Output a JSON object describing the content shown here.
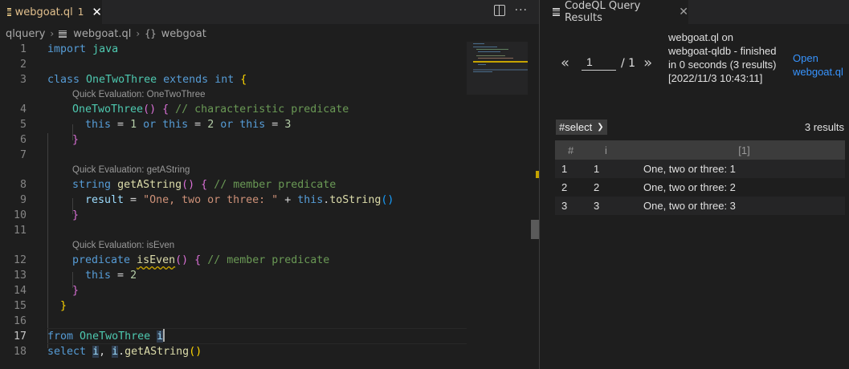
{
  "editor_tab": {
    "filename": "webgoat.ql",
    "problems": "1",
    "close": "✕"
  },
  "breadcrumb": {
    "folder": "qlquery",
    "file": "webgoat.ql",
    "symbol": "webgoat",
    "braces": "{}",
    "sep": "›"
  },
  "editor_actions": {
    "more": "···"
  },
  "code": {
    "line_numbers": [
      "1",
      "2",
      "3",
      "4",
      "5",
      "6",
      "7",
      "8",
      "9",
      "10",
      "11",
      "12",
      "13",
      "14",
      "15",
      "16",
      "17",
      "18"
    ],
    "l1": {
      "kw": "import",
      "lib": "java"
    },
    "l3": {
      "kw_class": "class",
      "name": "OneTwoThree",
      "kw_extends": "extends",
      "base": "int",
      "brace": "{"
    },
    "lens1": "Quick Evaluation: OneTwoThree",
    "l4": {
      "ctor": "OneTwoThree",
      "parens": "()",
      "brace": "{",
      "comment": "// characteristic predicate"
    },
    "l5": {
      "this1": "this",
      "eq1": " = ",
      "n1": "1",
      "or1": "or",
      "this2": "this",
      "eq2": " = ",
      "n2": "2",
      "or2": "or",
      "this3": "this",
      "eq3": " = ",
      "n3": "3"
    },
    "l6": {
      "brace": "}"
    },
    "lens2": "Quick Evaluation: getAString",
    "l8": {
      "type": "string",
      "method": "getAString",
      "parens": "()",
      "brace": "{",
      "comment": "// member predicate"
    },
    "l9": {
      "result": "result",
      "eq": " = ",
      "str": "\"One, two or three: \"",
      "plus": " + ",
      "this": "this",
      "dot": ".",
      "call": "toString",
      "parens": "()"
    },
    "l10": {
      "brace": "}"
    },
    "lens3": "Quick Evaluation: isEven",
    "l12": {
      "kw": "predicate",
      "method": "isEven",
      "parens": "()",
      "brace": "{",
      "comment": "// member predicate"
    },
    "l13": {
      "this": "this",
      "eq": " = ",
      "num": "2"
    },
    "l14": {
      "brace": "}"
    },
    "l15": {
      "brace": "}"
    },
    "l17": {
      "kw": "from",
      "type": "OneTwoThree",
      "var": "i"
    },
    "l18": {
      "kw": "select",
      "var1": "i",
      "comma": ", ",
      "var2": "i",
      "dot": ".",
      "call": "getAString",
      "parens": "()"
    }
  },
  "results_panel": {
    "tab_title": "CodeQL Query Results",
    "close": "✕",
    "pager": {
      "prev": "«",
      "page": "1",
      "total": "/ 1",
      "next": "»"
    },
    "run_info": "webgoat.ql on webgoat-qldb - finished in 0 seconds (3 results) [2022/11/3 10:43:11]",
    "open_link": "Open webgoat.ql",
    "result_set": "#select",
    "result_count": "3 results",
    "columns": [
      "#",
      "i",
      "[1]"
    ],
    "rows": [
      [
        "1",
        "1",
        "One, two or three: 1"
      ],
      [
        "2",
        "2",
        "One, two or three: 2"
      ],
      [
        "3",
        "3",
        "One, two or three: 3"
      ]
    ]
  }
}
